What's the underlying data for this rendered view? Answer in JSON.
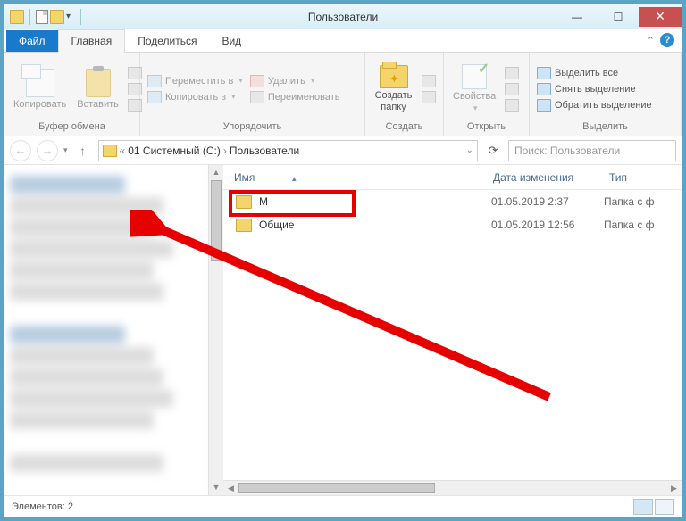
{
  "title": "Пользователи",
  "tabs": {
    "file": "Файл",
    "home": "Главная",
    "share": "Поделиться",
    "view": "Вид"
  },
  "ribbon": {
    "clipboard": {
      "copy": "Копировать",
      "paste": "Вставить",
      "group": "Буфер обмена"
    },
    "organize": {
      "move": "Переместить в",
      "copy_to": "Копировать в",
      "delete": "Удалить",
      "rename": "Переименовать",
      "group": "Упорядочить"
    },
    "new": {
      "folder": "Создать папку",
      "group": "Создать"
    },
    "open": {
      "properties": "Свойства",
      "group": "Открыть"
    },
    "select": {
      "all": "Выделить все",
      "none": "Снять выделение",
      "invert": "Обратить выделение",
      "group": "Выделить"
    }
  },
  "address": {
    "seg1": "01 Системный (C:)",
    "seg2": "Пользователи"
  },
  "search_placeholder": "Поиск: Пользователи",
  "columns": {
    "name": "Имя",
    "date": "Дата изменения",
    "type": "Тип"
  },
  "files": [
    {
      "name": "M",
      "date": "01.05.2019 2:37",
      "type": "Папка с ф"
    },
    {
      "name": "Общие",
      "date": "01.05.2019 12:56",
      "type": "Папка с ф"
    }
  ],
  "status": "Элементов: 2"
}
